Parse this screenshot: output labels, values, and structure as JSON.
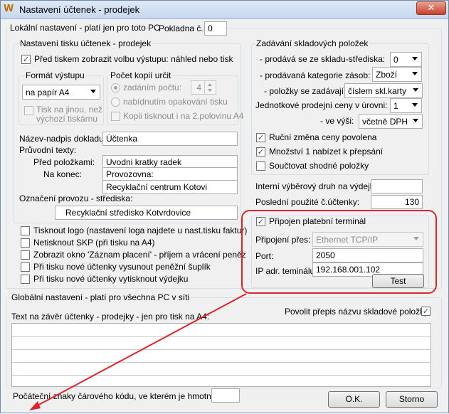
{
  "window": {
    "title": "Nastavení účtenek - prodejek",
    "icon": "app-logo-icon",
    "close_glyph": "✕"
  },
  "local": {
    "label": "Lokální nastavení - platí jen pro toto PC",
    "register_label": "Pokladna č.:",
    "register_value": "0"
  },
  "print": {
    "label": "Nastavení tisku účtenek - prodejek",
    "show_dialog": {
      "label": "Před tiskem zobrazit volbu výstupu: náhled nebo tisk",
      "checked": true
    },
    "format": {
      "label": "Formát výstupu",
      "value": "na papír A4",
      "other_printer_line1": "Tisk na jinou, než",
      "other_printer_line2": "výchozí tiskárnu"
    },
    "copies": {
      "label": "Počet kopií určit",
      "by_count": "zadáním počtu:",
      "count_value": "4",
      "by_repeat": "nabídnutím opakování tisku",
      "half_page": "Kopii tisknout i na 2.polovinu A4"
    },
    "doc_name_label": "Název-nadpis dokladu:",
    "doc_name_value": "Účtenka",
    "accompanying_label": "Průvodní texty:",
    "before_items_label": "Před položkami:",
    "before_items_value": "Uvodni kratky radek",
    "at_end_label": "Na konec:",
    "at_end_value1": "Provozovna:",
    "at_end_value2": "Recyklační centrum Kotovi",
    "outlet_label": "Označení provozu - střediska:",
    "outlet_value": "Recyklační středisko Kotvrdovice"
  },
  "options": [
    "Tisknout logo (nastavení loga najdete u nast.tisku faktur)",
    "Netisknout SKP (při tisku na A4)",
    "Zobrazit okno 'Záznam placení' - příjem a vrácení peněz",
    "Při tisku nové účtenky vysunout peněžní šuplík",
    "Při tisku nové účtenky vytisknout výdejku"
  ],
  "stock": {
    "label": "Zadávání skladových položek",
    "sold_from_label": "- prodává se ze skladu-střediska:",
    "sold_from_value": "0",
    "category_label": "- prodávaná kategorie zásob:",
    "category_value": "Zboží",
    "items_by_label": "- položky se zadávají:",
    "items_by_value": "číslem skl.karty",
    "unit_price_label": "Jednotkové prodejní ceny v úrovni:",
    "unit_price_value": "1",
    "amount_label": "- ve výši:",
    "amount_value": "včetně DPH",
    "manual_price": {
      "label": "Ruční změna ceny povolena",
      "checked": true
    },
    "qty_prefill": {
      "label": "Množství 1 nabízet k přepsání",
      "checked": true
    },
    "sum_same": {
      "label": "Součtovat shodné položky",
      "checked": false
    }
  },
  "internal_label": "Interní výběrový druh na výdejky:",
  "internal_value": "",
  "last_receipt_label": "Poslední použité č.účtenky:",
  "last_receipt_value": "130",
  "terminal": {
    "checkbox_label": "Připojen platební terminál",
    "checked": true,
    "connection_label": "Připojení přes:",
    "connection_value": "Ethernet TCP/IP",
    "port_label": "Port:",
    "port_value": "2050",
    "ip_label": "IP adr. teminálu:",
    "ip_value": "192.168.001.102",
    "test_button": "Test"
  },
  "global": {
    "label": "Globální nastavení - platí pro všechna PC v síti",
    "allow_rename": {
      "label": "Povolit přepis názvu skladové položky",
      "checked": true
    },
    "footer_text_label": "Text na závěr účtenky - prodejky - jen pro tisk na A4:",
    "barcode_label": "Počáteční znaky čárového kódu, ve kterém je hmotnost:",
    "barcode_value": ""
  },
  "buttons": {
    "ok": "O.K.",
    "cancel": "Storno"
  },
  "colors": {
    "highlight": "#d8262c",
    "arrow": "#d8262c"
  }
}
